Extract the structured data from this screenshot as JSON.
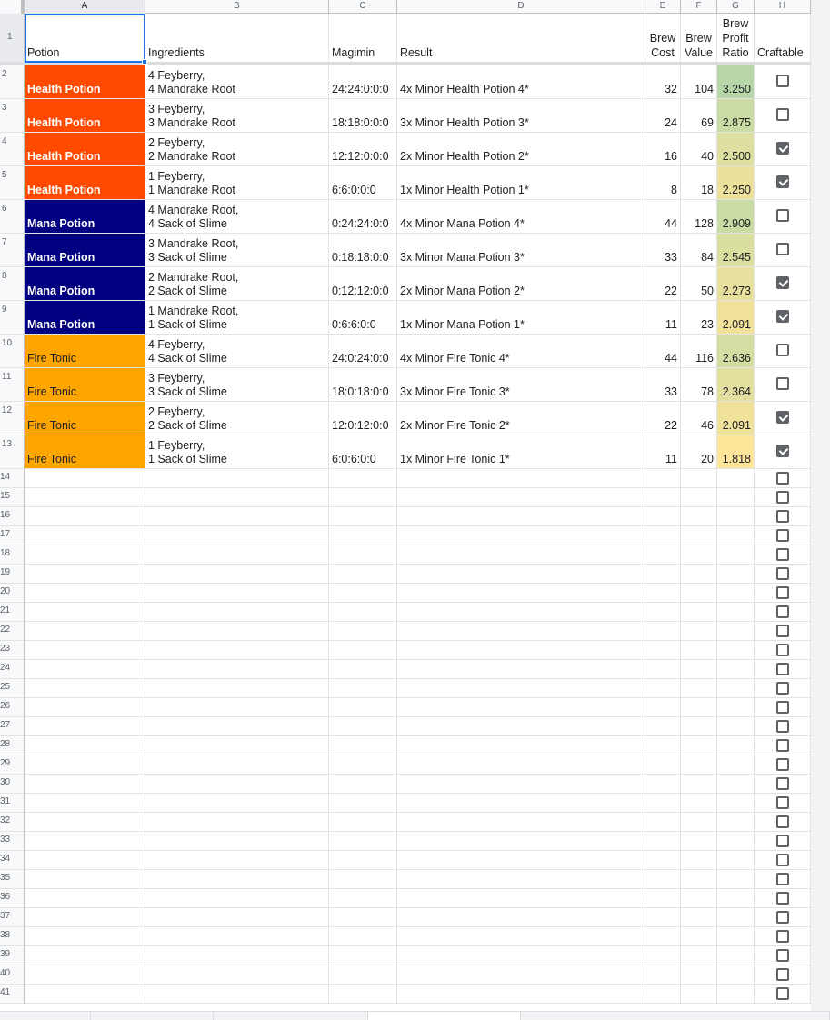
{
  "columns": [
    "A",
    "B",
    "C",
    "D",
    "E",
    "F",
    "G",
    "H"
  ],
  "header_row": {
    "potion": "Potion",
    "ingredients": "Ingredients",
    "magimin": "Magimin",
    "result": "Result",
    "brew_cost": "Brew\nCost",
    "brew_value": "Brew\nValue",
    "brew_profit_ratio": "Brew\nProfit\nRatio",
    "craftable": "Craftable"
  },
  "potion_colors": {
    "Health Potion": {
      "bg": "#ff4a00",
      "fg": "#ffffff",
      "bold": true
    },
    "Mana Potion": {
      "bg": "#000080",
      "fg": "#ffffff",
      "bold": true
    },
    "Fire Tonic": {
      "bg": "#ffa500",
      "fg": "#202124",
      "bold": false
    }
  },
  "rows": [
    {
      "potion": "Health Potion",
      "ingredients": "4 Feyberry,\n4 Mandrake Root",
      "magimin": "24:24:0:0:0",
      "result": "4x Minor Health Potion 4*",
      "cost": "32",
      "value": "104",
      "ratio": "3.250",
      "ratio_color": "#b7d7a8",
      "craftable": false
    },
    {
      "potion": "Health Potion",
      "ingredients": "3 Feyberry,\n3 Mandrake Root",
      "magimin": "18:18:0:0:0",
      "result": "3x Minor Health Potion 3*",
      "cost": "24",
      "value": "69",
      "ratio": "2.875",
      "ratio_color": "#cadca3",
      "craftable": false
    },
    {
      "potion": "Health Potion",
      "ingredients": "2 Feyberry,\n2 Mandrake Root",
      "magimin": "12:12:0:0:0",
      "result": "2x Minor Health Potion 2*",
      "cost": "16",
      "value": "40",
      "ratio": "2.500",
      "ratio_color": "#dde0a0",
      "craftable": true
    },
    {
      "potion": "Health Potion",
      "ingredients": "1 Feyberry,\n1 Mandrake Root",
      "magimin": "6:6:0:0:0",
      "result": "1x Minor Health Potion 1*",
      "cost": "8",
      "value": "18",
      "ratio": "2.250",
      "ratio_color": "#ece19c",
      "craftable": true
    },
    {
      "potion": "Mana Potion",
      "ingredients": "4 Mandrake Root,\n4 Sack of Slime",
      "magimin": "0:24:24:0:0",
      "result": "4x Minor Mana Potion 4*",
      "cost": "44",
      "value": "128",
      "ratio": "2.909",
      "ratio_color": "#c8dca4",
      "craftable": false
    },
    {
      "potion": "Mana Potion",
      "ingredients": "3 Mandrake Root,\n3 Sack of Slime",
      "magimin": "0:18:18:0:0",
      "result": "3x Minor Mana Potion 3*",
      "cost": "33",
      "value": "84",
      "ratio": "2.545",
      "ratio_color": "#dadfa0",
      "craftable": false
    },
    {
      "potion": "Mana Potion",
      "ingredients": "2 Mandrake Root,\n2 Sack of Slime",
      "magimin": "0:12:12:0:0",
      "result": "2x Minor Mana Potion 2*",
      "cost": "22",
      "value": "50",
      "ratio": "2.273",
      "ratio_color": "#e8e09e",
      "craftable": true
    },
    {
      "potion": "Mana Potion",
      "ingredients": "1 Mandrake Root,\n1 Sack of Slime",
      "magimin": "0:6:6:0:0",
      "result": "1x Minor Mana Potion 1*",
      "cost": "11",
      "value": "23",
      "ratio": "2.091",
      "ratio_color": "#f1e29b",
      "craftable": true
    },
    {
      "potion": "Fire Tonic",
      "ingredients": "4 Feyberry,\n4 Sack of Slime",
      "magimin": "24:0:24:0:0",
      "result": "4x Minor Fire Tonic 4*",
      "cost": "44",
      "value": "116",
      "ratio": "2.636",
      "ratio_color": "#d5dea2",
      "craftable": false
    },
    {
      "potion": "Fire Tonic",
      "ingredients": "3 Feyberry,\n3 Sack of Slime",
      "magimin": "18:0:18:0:0",
      "result": "3x Minor Fire Tonic 3*",
      "cost": "33",
      "value": "78",
      "ratio": "2.364",
      "ratio_color": "#e3df9f",
      "craftable": false
    },
    {
      "potion": "Fire Tonic",
      "ingredients": "2 Feyberry,\n2 Sack of Slime",
      "magimin": "12:0:12:0:0",
      "result": "2x Minor Fire Tonic 2*",
      "cost": "22",
      "value": "46",
      "ratio": "2.091",
      "ratio_color": "#f1e29b",
      "craftable": true
    },
    {
      "potion": "Fire Tonic",
      "ingredients": "1 Feyberry,\n1 Sack of Slime",
      "magimin": "6:0:6:0:0",
      "result": "1x Minor Fire Tonic 1*",
      "cost": "11",
      "value": "20",
      "ratio": "1.818",
      "ratio_color": "#ffe599",
      "craftable": true
    }
  ],
  "empty_row_numbers": [
    14,
    15,
    16,
    17,
    18,
    19,
    20,
    21,
    22,
    23,
    24,
    25,
    26,
    27,
    28,
    29,
    30,
    31,
    32,
    33,
    34,
    35,
    36,
    37,
    38,
    39,
    40,
    41
  ],
  "selected_cell": "A1"
}
